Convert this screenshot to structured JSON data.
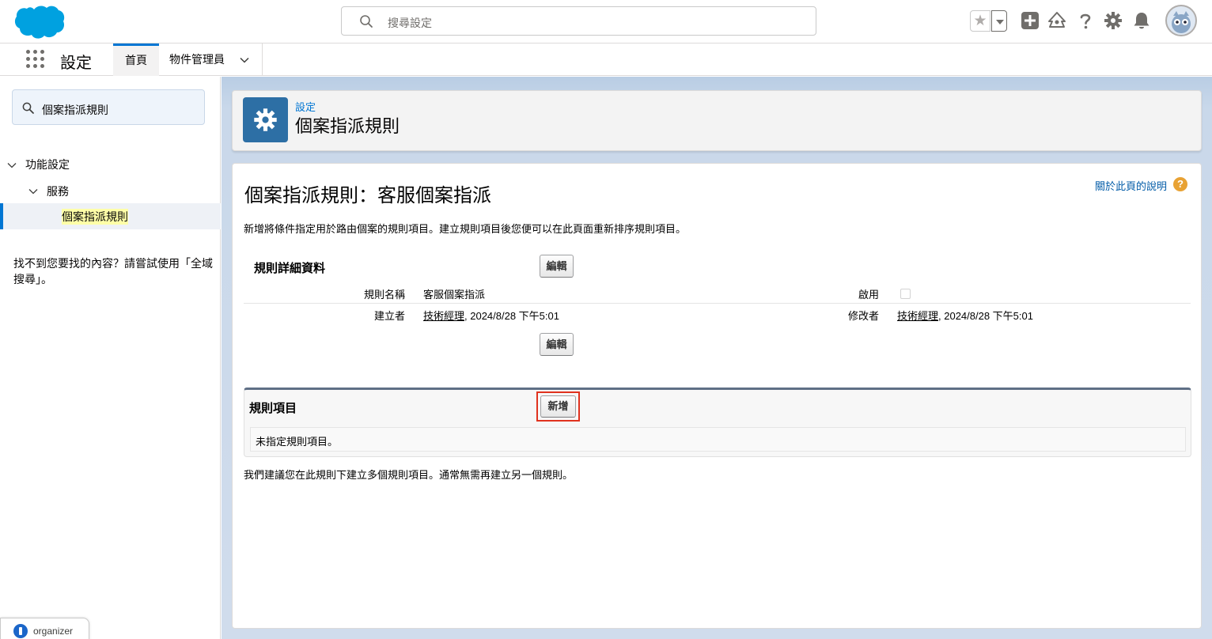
{
  "header": {
    "search_placeholder": "搜尋設定",
    "icons": [
      "favorites-star-icon",
      "favorites-dropdown-icon",
      "global-actions-icon",
      "trailhead-icon",
      "help-icon",
      "setup-gear-icon",
      "notifications-bell-icon",
      "user-avatar"
    ]
  },
  "nav": {
    "app_name": "設定",
    "tabs": [
      {
        "label": "首頁",
        "active": true
      },
      {
        "label": "物件管理員",
        "has_menu": true
      }
    ]
  },
  "sidebar": {
    "quickfind_value": "個案指派規則",
    "tree": [
      {
        "label": "功能設定",
        "level": 0,
        "expanded": true
      },
      {
        "label": "服務",
        "level": 1,
        "expanded": true
      },
      {
        "label": "個案指派規則",
        "level": 2,
        "selected": true
      }
    ],
    "not_found_text": "找不到您要找的內容？請嘗試使用「全域搜尋」。"
  },
  "page_header": {
    "eyebrow": "設定",
    "title": "個案指派規則"
  },
  "content": {
    "help_link": "關於此頁的說明",
    "title": "個案指派規則：客服個案指派",
    "description": "新增將條件指定用於路由個案的規則項目。建立規則項目後您便可以在此頁面重新排序規則項目。",
    "detail_section": {
      "title": "規則詳細資料",
      "edit_label": "編輯",
      "rule_name_label": "規則名稱",
      "rule_name_value": "客服個案指派",
      "active_label": "啟用",
      "active_checked": false,
      "created_by_label": "建立者",
      "created_by_user": "技術經理",
      "created_by_date": ", 2024/8/28 下午5:01",
      "modified_by_label": "修改者",
      "modified_by_user": "技術經理",
      "modified_by_date": ", 2024/8/28 下午5:01"
    },
    "rule_items": {
      "title": "規則項目",
      "new_label": "新增",
      "empty_text": "未指定規則項目。"
    },
    "footer_text": "我們建議您在此規則下建立多個規則項目。通常無需再建立另一個規則。"
  },
  "organizer": {
    "label": "organizer"
  },
  "colors": {
    "brand_blue": "#0176d3",
    "setup_icon_bg": "#2d6fa5",
    "highlight_red": "#e0321e",
    "help_orange": "#e8a234"
  }
}
